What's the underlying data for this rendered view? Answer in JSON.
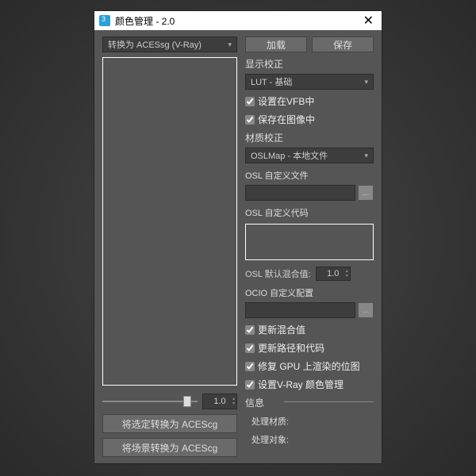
{
  "titlebar": {
    "title": "颜色管理 - 2.0"
  },
  "left": {
    "convert_dropdown": "转换为 ACESsg (V-Ray)",
    "slider_value": "1.0",
    "btn_convert_selection": "将选定转换为 ACEScg",
    "btn_convert_scene": "将场景转换为 ACEScg"
  },
  "right": {
    "btn_load": "加载",
    "btn_save": "保存",
    "display_section": "显示校正",
    "lut_dropdown": "LUT - 基础",
    "cb_vfb": "设置在VFB中",
    "cb_save_image": "保存在图像中",
    "material_section": "材质校正",
    "oslmap_dropdown": "OSLMap - 本地文件",
    "osl_file_label": "OSL 自定义文件",
    "osl_code_label": "OSL 自定义代码",
    "osl_mix_label": "OSL 默认混合值:",
    "osl_mix_value": "1.0",
    "ocio_label": "OCIO 自定义配置",
    "cb_update_mix": "更新混合值",
    "cb_update_path": "更新路径和代码",
    "cb_fix_gpu": "修复 GPU 上渲染的位图",
    "cb_set_vray": "设置V-Ray 颜色管理",
    "info_label": "信息",
    "info_material": "处理材质:",
    "info_object": "处理对象:"
  }
}
